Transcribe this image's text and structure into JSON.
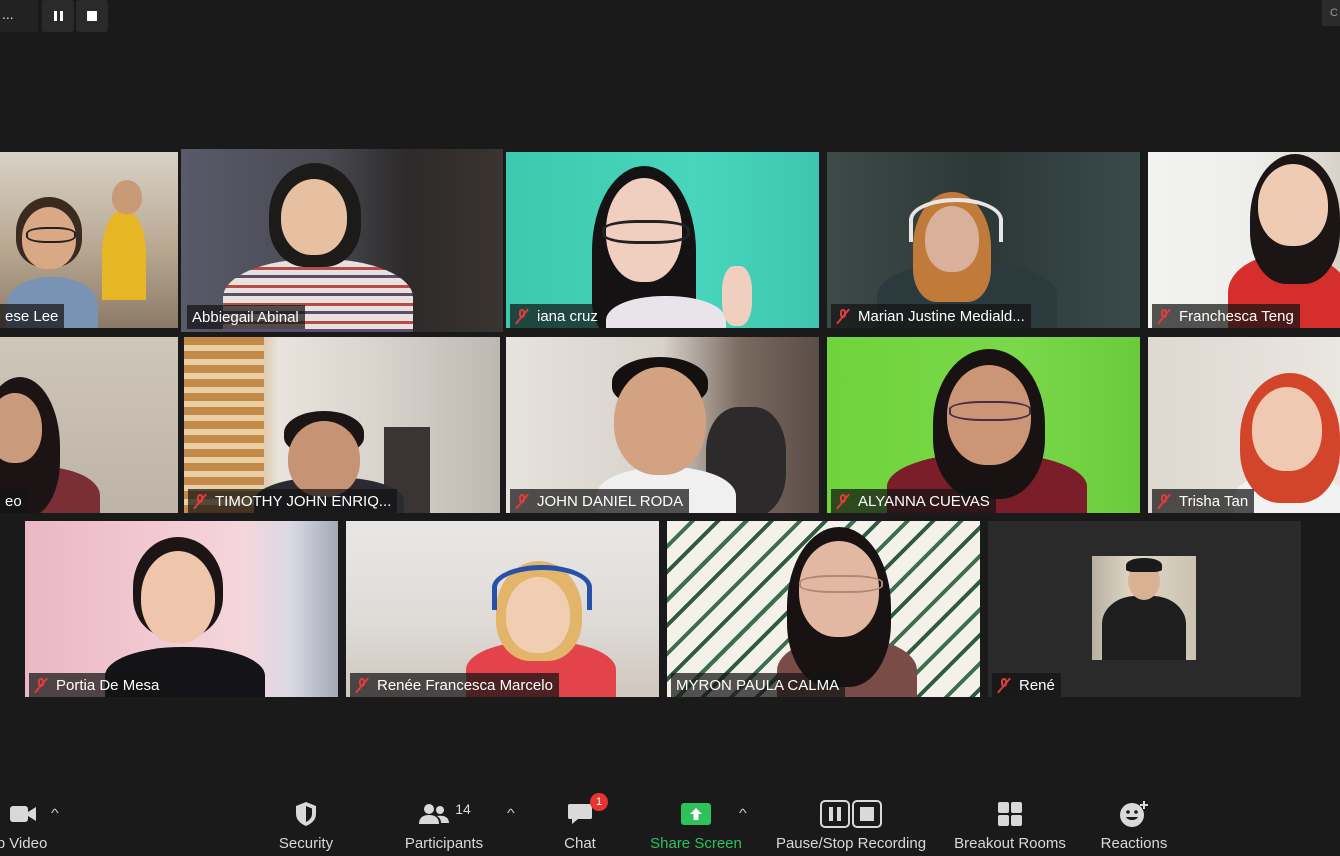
{
  "recording_bar": {
    "menu_label": "..."
  },
  "corner_label": "C",
  "participants": [
    {
      "name": "ese Lee",
      "muted": false
    },
    {
      "name": "Abbiegail Abinal",
      "muted": false
    },
    {
      "name": "iana cruz",
      "muted": true
    },
    {
      "name": "Marian Justine Mediald...",
      "muted": true
    },
    {
      "name": "Franchesca Teng",
      "muted": true
    },
    {
      "name": "eo",
      "muted": false
    },
    {
      "name": "TIMOTHY JOHN ENRIQ...",
      "muted": true
    },
    {
      "name": "JOHN DANIEL RODA",
      "muted": true
    },
    {
      "name": "ALYANNA CUEVAS",
      "muted": true
    },
    {
      "name": "Trisha Tan",
      "muted": true
    },
    {
      "name": "Portia De Mesa",
      "muted": true
    },
    {
      "name": "Renée Francesca Marcelo",
      "muted": true
    },
    {
      "name": "MYRON PAULA CALMA",
      "muted": false
    },
    {
      "name": "René",
      "muted": true
    }
  ],
  "toolbar": {
    "video_label": "p Video",
    "security_label": "Security",
    "participants_label": "Participants",
    "participants_count": "14",
    "chat_label": "Chat",
    "chat_badge": "1",
    "share_label": "Share Screen",
    "recording_label": "Pause/Stop Recording",
    "breakout_label": "Breakout Rooms",
    "reactions_label": "Reactions"
  },
  "colors": {
    "speaking_border": "#d8e85a",
    "share_green": "#2ec15c",
    "muted_red": "#e03c3c",
    "badge_red": "#e8332e"
  },
  "icons": [
    "pause-icon",
    "stop-icon",
    "video-camera-icon",
    "shield-icon",
    "people-icon",
    "chat-bubble-icon",
    "share-screen-icon",
    "record-pause-stop-icon",
    "breakout-grid-icon",
    "reactions-smile-icon",
    "muted-mic-icon",
    "caret-up-icon"
  ]
}
